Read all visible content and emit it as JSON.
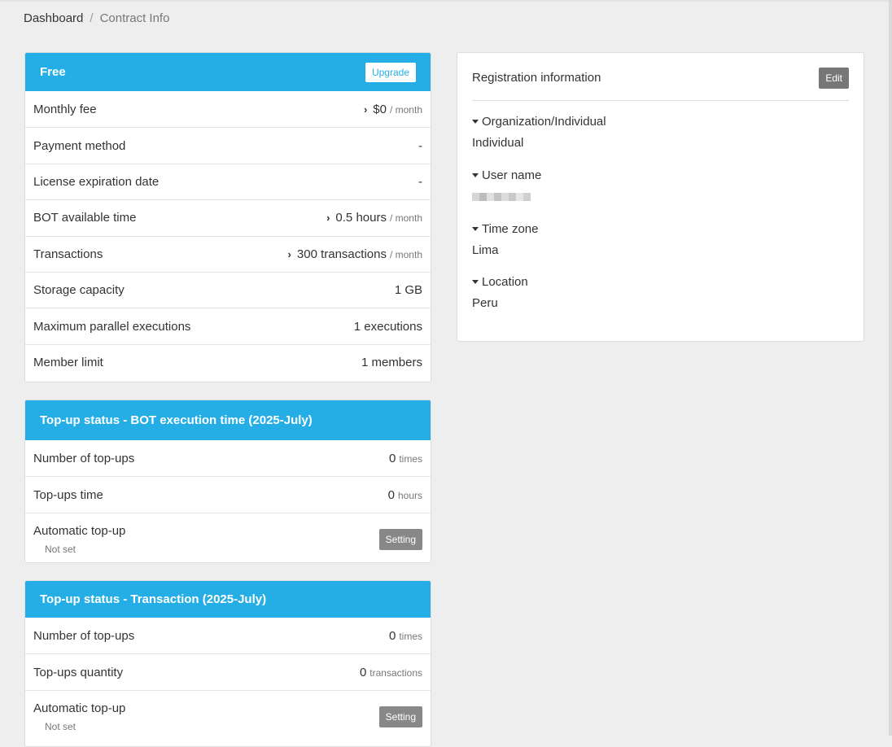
{
  "breadcrumb": {
    "home": "Dashboard",
    "separator": "/",
    "current": "Contract Info"
  },
  "plan": {
    "name": "Free",
    "upgrade_label": "Upgrade",
    "rows": [
      {
        "label": "Monthly fee",
        "value": "$0",
        "unit": "/ month",
        "chevron": true
      },
      {
        "label": "Payment method",
        "value": "-",
        "unit": "",
        "chevron": false
      },
      {
        "label": "License expiration date",
        "value": "-",
        "unit": "",
        "chevron": false
      },
      {
        "label": "BOT available time",
        "value": "0.5 hours",
        "unit": "/ month",
        "chevron": true
      },
      {
        "label": "Transactions",
        "value": "300 transactions",
        "unit": "/ month",
        "chevron": true
      },
      {
        "label": "Storage capacity",
        "value": "1 GB",
        "unit": "",
        "chevron": false
      },
      {
        "label": "Maximum parallel executions",
        "value": "1 executions",
        "unit": "",
        "chevron": false
      },
      {
        "label": "Member limit",
        "value": "1 members",
        "unit": "",
        "chevron": false
      }
    ]
  },
  "topup_bot": {
    "title": "Top-up status - BOT execution time (2025-July)",
    "count_label": "Number of top-ups",
    "count_value": "0",
    "count_unit": "times",
    "amount_label": "Top-ups time",
    "amount_value": "0",
    "amount_unit": "hours",
    "auto_label": "Automatic top-up",
    "auto_status": "Not set",
    "setting_label": "Setting"
  },
  "topup_tx": {
    "title": "Top-up status - Transaction (2025-July)",
    "count_label": "Number of top-ups",
    "count_value": "0",
    "count_unit": "times",
    "amount_label": "Top-ups quantity",
    "amount_value": "0",
    "amount_unit": "transactions",
    "auto_label": "Automatic top-up",
    "auto_status": "Not set",
    "setting_label": "Setting"
  },
  "registration": {
    "title": "Registration information",
    "edit_label": "Edit",
    "fields": [
      {
        "label": "Organization/Individual",
        "value": "Individual"
      },
      {
        "label": "User name",
        "value": ""
      },
      {
        "label": "Time zone",
        "value": "Lima"
      },
      {
        "label": "Location",
        "value": "Peru"
      }
    ]
  },
  "colors": {
    "header_blue": "#25aee5",
    "button_gray": "#888888",
    "background": "#eeeeee"
  }
}
